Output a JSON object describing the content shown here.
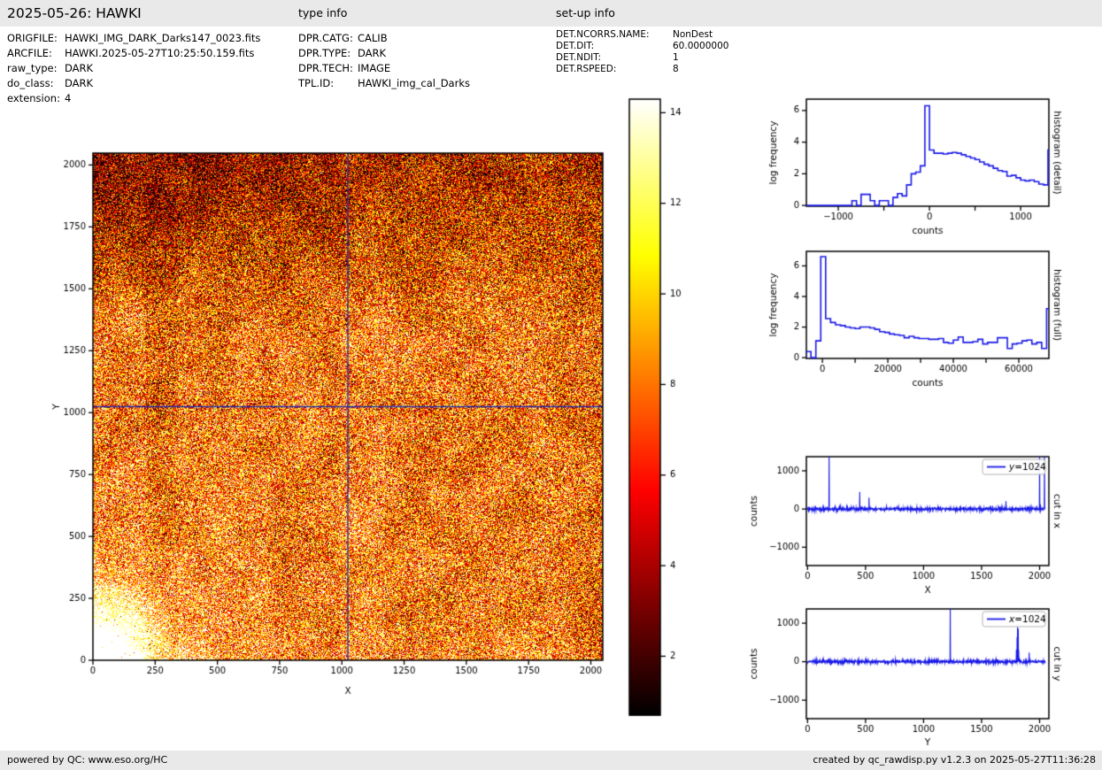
{
  "header": {
    "title": "2025-05-26: HAWKI",
    "type_info_heading": "type info",
    "setup_info_heading": "set-up info"
  },
  "file_info": [
    {
      "label": "ORIGFILE:",
      "value": "HAWKI_IMG_DARK_Darks147_0023.fits"
    },
    {
      "label": "ARCFILE:",
      "value": "HAWKI.2025-05-27T10:25:50.159.fits"
    },
    {
      "label": "raw_type:",
      "value": "DARK"
    },
    {
      "label": "do_class:",
      "value": "DARK"
    },
    {
      "label": "extension:",
      "value": "4"
    }
  ],
  "type_info": [
    {
      "label": "DPR.CATG:",
      "value": "CALIB"
    },
    {
      "label": "DPR.TYPE:",
      "value": "DARK"
    },
    {
      "label": "DPR.TECH:",
      "value": "IMAGE"
    },
    {
      "label": "TPL.ID:",
      "value": "HAWKI_img_cal_Darks"
    }
  ],
  "setup_info": [
    {
      "label": "DET.NCORRS.NAME:",
      "value": "NonDest"
    },
    {
      "label": "DET.DIT:",
      "value": "60.0000000"
    },
    {
      "label": "DET.NDIT:",
      "value": "1"
    },
    {
      "label": "DET.RSPEED:",
      "value": "8"
    }
  ],
  "footer": {
    "left": "powered by QC: www.eso.org/HC",
    "right": "created by qc_rawdisp.py v1.2.3 on 2025-05-27T11:36:28"
  },
  "colors": {
    "line_blue": "#1a1ae6",
    "crosshair_blue": "#2323aa",
    "bar_bg": "#e9e9e9",
    "axis_black": "#000000",
    "legend_border": "#b3b3b3"
  },
  "chart_data": [
    {
      "id": "main_image",
      "type": "heatmap",
      "xlabel": "X",
      "ylabel": "Y",
      "xlim": [
        0,
        2048
      ],
      "ylim": [
        0,
        2048
      ],
      "xticks": [
        0,
        250,
        500,
        750,
        1000,
        1250,
        1500,
        1750,
        2000
      ],
      "yticks": [
        0,
        250,
        500,
        750,
        1000,
        1250,
        1500,
        1750,
        2000
      ],
      "colormap": "hot",
      "crosshair": {
        "x": 1024,
        "y": 1024
      },
      "noise_seed": 1234,
      "shading": {
        "base": 0.55,
        "noise_amp": 0.88,
        "corner_glow": {
          "x": 0,
          "y": 0,
          "sigma": 165,
          "amp": 0.85
        },
        "soft_glow": {
          "sigma": 420,
          "amp": 0.18
        },
        "top_dark_amp": 0.36,
        "left_band": [
          210,
          340
        ],
        "bright_column": [
          990,
          1170
        ]
      }
    },
    {
      "id": "colorbar",
      "type": "colorbar",
      "colormap": "hot",
      "vmin": 0.7,
      "vmax": 14.3,
      "ticks": [
        2,
        4,
        6,
        8,
        10,
        12,
        14
      ]
    },
    {
      "id": "hist_detail",
      "type": "step-histogram",
      "xlabel": "counts",
      "ylabel": "log frequency",
      "side_label": "histogram (detail)",
      "xlim": [
        -1350,
        1310
      ],
      "ylim": [
        -0.05,
        6.72
      ],
      "xticks": [
        -1000,
        0,
        1000
      ],
      "xticks_unlabeled": [
        -500,
        500
      ],
      "yticks": [
        0,
        2,
        4,
        6
      ],
      "bin_start": -1350,
      "bin_width": 50,
      "log_frequency": [
        0,
        0,
        0,
        0,
        0,
        0,
        0,
        0,
        0,
        0,
        0.3,
        0,
        0.7,
        0.7,
        0.3,
        0,
        0.3,
        0.3,
        0,
        0.5,
        0.75,
        0.6,
        1.3,
        2.0,
        2.1,
        2.5,
        6.3,
        3.5,
        3.3,
        3.3,
        3.25,
        3.3,
        3.35,
        3.3,
        3.2,
        3.1,
        3.0,
        2.9,
        2.75,
        2.6,
        2.5,
        2.35,
        2.2,
        2.15,
        1.85,
        1.9,
        1.75,
        1.6,
        1.55,
        1.6,
        1.5,
        1.35,
        1.3,
        3.5
      ]
    },
    {
      "id": "hist_full",
      "type": "step-histogram",
      "xlabel": "counts",
      "ylabel": "log frequency",
      "side_label": "histogram (full)",
      "xlim": [
        -4900,
        69200
      ],
      "ylim": [
        -0.05,
        6.95
      ],
      "xticks": [
        0,
        20000,
        40000,
        60000
      ],
      "xticks_unlabeled": [
        10000,
        30000,
        50000
      ],
      "yticks": [
        0,
        2,
        4,
        6
      ],
      "bin_start": -5000,
      "bin_width": 1500,
      "log_frequency": [
        0.4,
        0,
        1.1,
        6.6,
        2.55,
        2.3,
        2.15,
        2.1,
        2.0,
        1.95,
        1.9,
        2.0,
        2.0,
        1.95,
        1.85,
        1.7,
        1.65,
        1.55,
        1.5,
        1.45,
        1.3,
        1.4,
        1.3,
        1.25,
        1.25,
        1.2,
        1.2,
        1.25,
        1.0,
        0.95,
        1.15,
        1.35,
        1.0,
        1.0,
        1.05,
        1.2,
        0.9,
        1.0,
        1.0,
        1.3,
        1.3,
        0.6,
        0.9,
        0.95,
        1.1,
        1.15,
        0.9,
        1.0,
        0.6,
        3.2
      ]
    },
    {
      "id": "cut_x",
      "type": "line",
      "xlabel": "X",
      "ylabel": "counts",
      "side_label": "cut in x",
      "legend_label": "y=1024",
      "xlim": [
        -10,
        2080
      ],
      "ylim": [
        -1480,
        1370
      ],
      "xticks": [
        0,
        500,
        1000,
        1500,
        2000
      ],
      "yticks": [
        -1000,
        0,
        1000
      ],
      "noise_seed": 77,
      "noise_sigma": 20,
      "spikes": [
        {
          "x": 185,
          "counts": 1450
        },
        {
          "x": 450,
          "counts": 450
        },
        {
          "x": 530,
          "counts": 300
        },
        {
          "x": 1580,
          "counts": 85
        },
        {
          "x": 1710,
          "counts": 205
        },
        {
          "x": 2000,
          "counts": 1450
        },
        {
          "x": 2042,
          "counts": 1450
        }
      ]
    },
    {
      "id": "cut_y",
      "type": "line",
      "xlabel": "Y",
      "ylabel": "counts",
      "side_label": "cut in y",
      "legend_label": "x=1024",
      "xlim": [
        -10,
        2080
      ],
      "ylim": [
        -1480,
        1370
      ],
      "xticks": [
        0,
        500,
        1000,
        1500,
        2000
      ],
      "yticks": [
        -1000,
        0,
        1000
      ],
      "noise_seed": 99,
      "noise_sigma": 20,
      "spikes": [
        {
          "x": 200,
          "counts": -95
        },
        {
          "x": 1230,
          "counts": 1450
        },
        {
          "x": 1570,
          "counts": -80
        },
        {
          "x": 1800,
          "counts": 310
        },
        {
          "x": 1806,
          "counts": 640
        },
        {
          "x": 1810,
          "counts": 900
        },
        {
          "x": 1815,
          "counts": 860
        },
        {
          "x": 1820,
          "counts": 300
        },
        {
          "x": 1910,
          "counts": 235
        }
      ]
    }
  ]
}
